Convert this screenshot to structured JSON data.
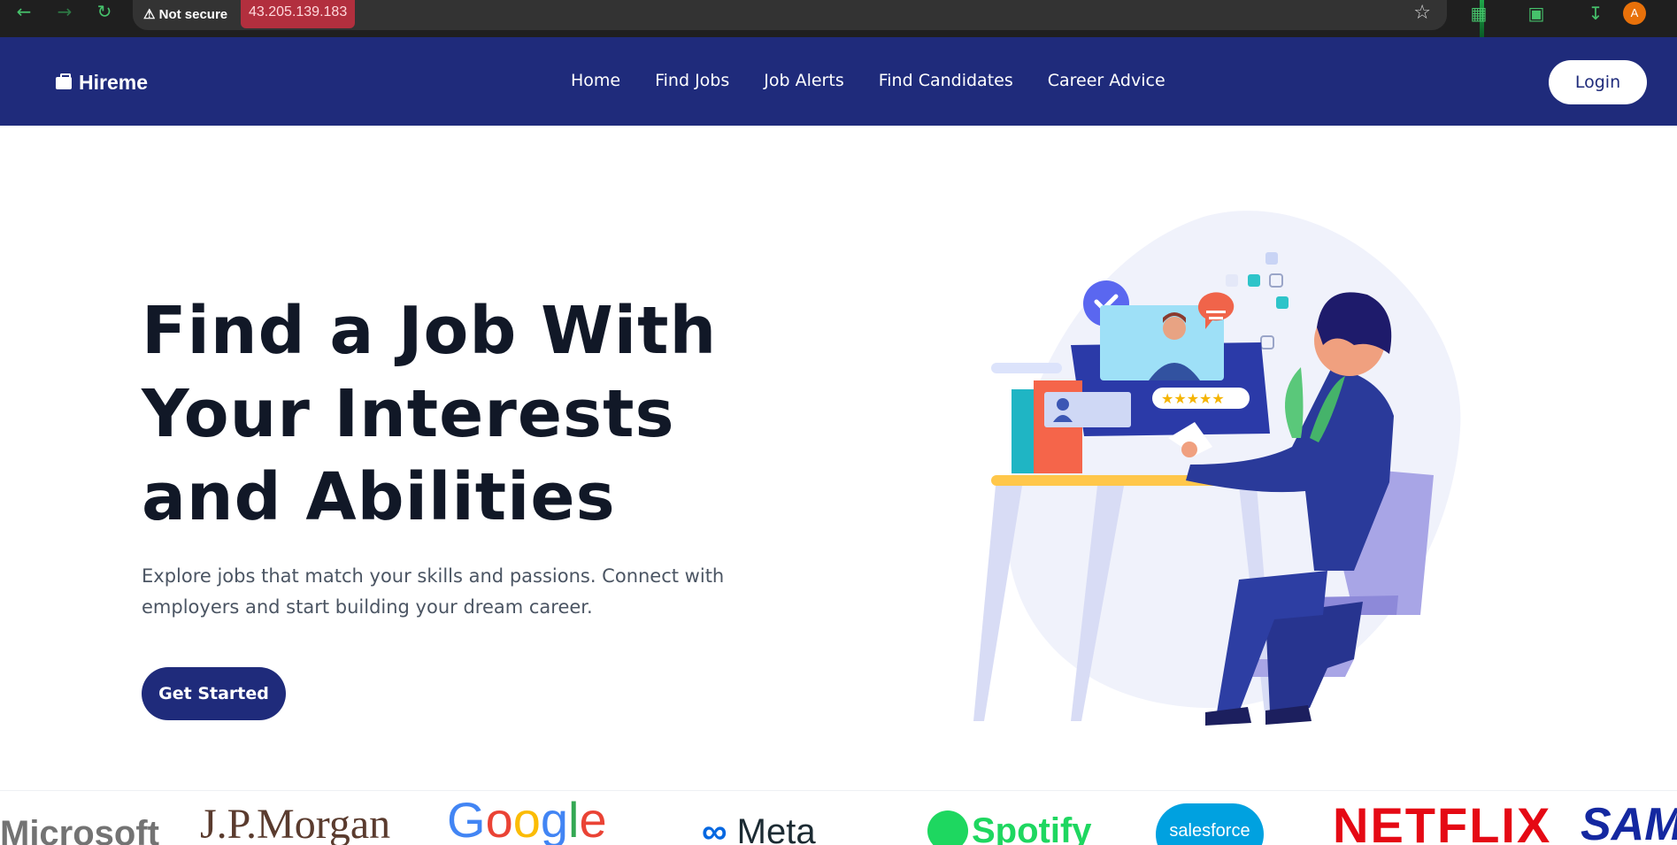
{
  "browser": {
    "security_label": "Not secure",
    "url": "43.205.139.183",
    "profile_initial": "A",
    "icons": [
      "back-icon",
      "forward-icon",
      "reload-icon",
      "warning-icon",
      "star-icon",
      "extension-icon",
      "screenshot-icon",
      "download-icon"
    ]
  },
  "header": {
    "logo_text": "Hireme",
    "nav": [
      "Home",
      "Find Jobs",
      "Job Alerts",
      "Find Candidates",
      "Career Advice"
    ],
    "login_label": "Login",
    "bg_color": "#1f2b7b"
  },
  "hero": {
    "title_lines": [
      "Find a Job With",
      "Your Interests",
      "and Abilities"
    ],
    "subtitle_lines": [
      "Explore jobs that match your skills and passions. Connect with",
      "employers and start building your dream career."
    ],
    "cta_label": "Get Started",
    "illustration": "person-at-desk-video-interview"
  },
  "companies": {
    "microsoft": "Microsoft",
    "jpmorgan": "J.P.Morgan",
    "google_letters": [
      "G",
      "o",
      "o",
      "g",
      "l",
      "e"
    ],
    "meta": "Meta",
    "meta_symbol": "∞",
    "spotify": "Spotify",
    "salesforce": "salesforce",
    "netflix": "NETFLIX",
    "samsung": "SAMS"
  }
}
